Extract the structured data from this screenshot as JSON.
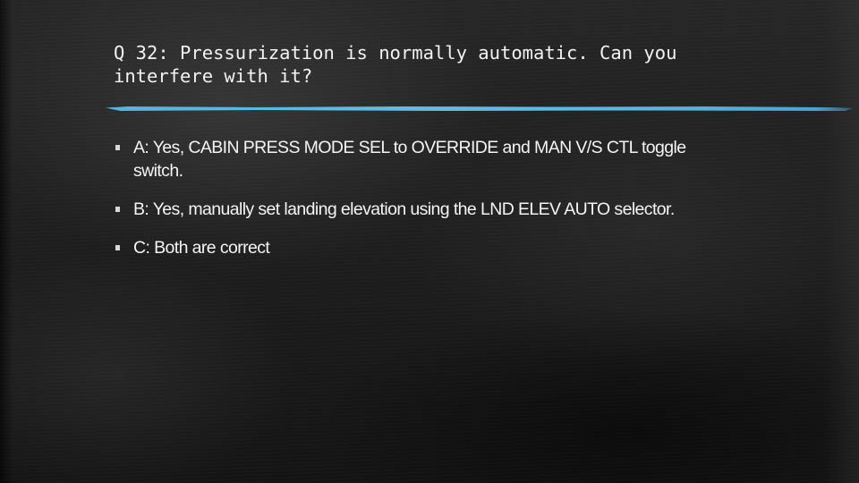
{
  "slide": {
    "title": "Q 32: Pressurization is normally automatic. Can you interfere with it?",
    "accent_color": "#5ab8e0",
    "answers": [
      {
        "label": "A: Yes, CABIN PRESS MODE SEL to OVERRIDE and MAN V/S CTL toggle switch."
      },
      {
        "label": "B: Yes, manually set landing elevation using the LND ELEV AUTO selector."
      },
      {
        "label": "C: Both are correct"
      }
    ]
  }
}
